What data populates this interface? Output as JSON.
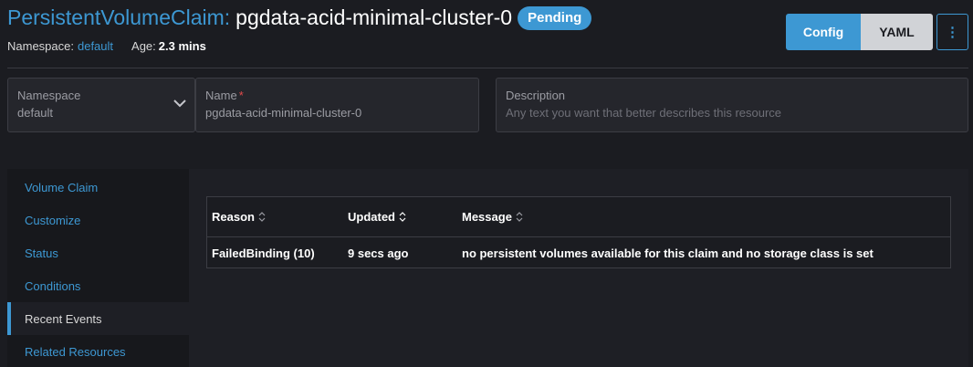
{
  "header": {
    "resource_type": "PersistentVolumeClaim:",
    "resource_name": "pgdata-acid-minimal-cluster-0",
    "status_badge": "Pending",
    "namespace_label": "Namespace:",
    "namespace_value": "default",
    "age_label": "Age:",
    "age_value": "2.3 mins",
    "config_button": "Config",
    "yaml_button": "YAML",
    "more_button": "⋮"
  },
  "form": {
    "namespace": {
      "label": "Namespace",
      "value": "default"
    },
    "name": {
      "label": "Name",
      "required_marker": "*",
      "value": "pgdata-acid-minimal-cluster-0"
    },
    "description": {
      "label": "Description",
      "placeholder": "Any text you want that better describes this resource"
    }
  },
  "tabs": [
    {
      "label": "Volume Claim",
      "active": false
    },
    {
      "label": "Customize",
      "active": false
    },
    {
      "label": "Status",
      "active": false
    },
    {
      "label": "Conditions",
      "active": false
    },
    {
      "label": "Recent Events",
      "active": true
    },
    {
      "label": "Related Resources",
      "active": false
    }
  ],
  "events_table": {
    "columns": [
      "Reason",
      "Updated",
      "Message"
    ],
    "rows": [
      {
        "reason": "FailedBinding (10)",
        "updated": "9 secs ago",
        "message": "no persistent volumes available for this claim and no storage class is set"
      }
    ]
  },
  "colors": {
    "accent": "#3d98d3",
    "background": "#1b1c21",
    "required": "#e24b4b"
  }
}
